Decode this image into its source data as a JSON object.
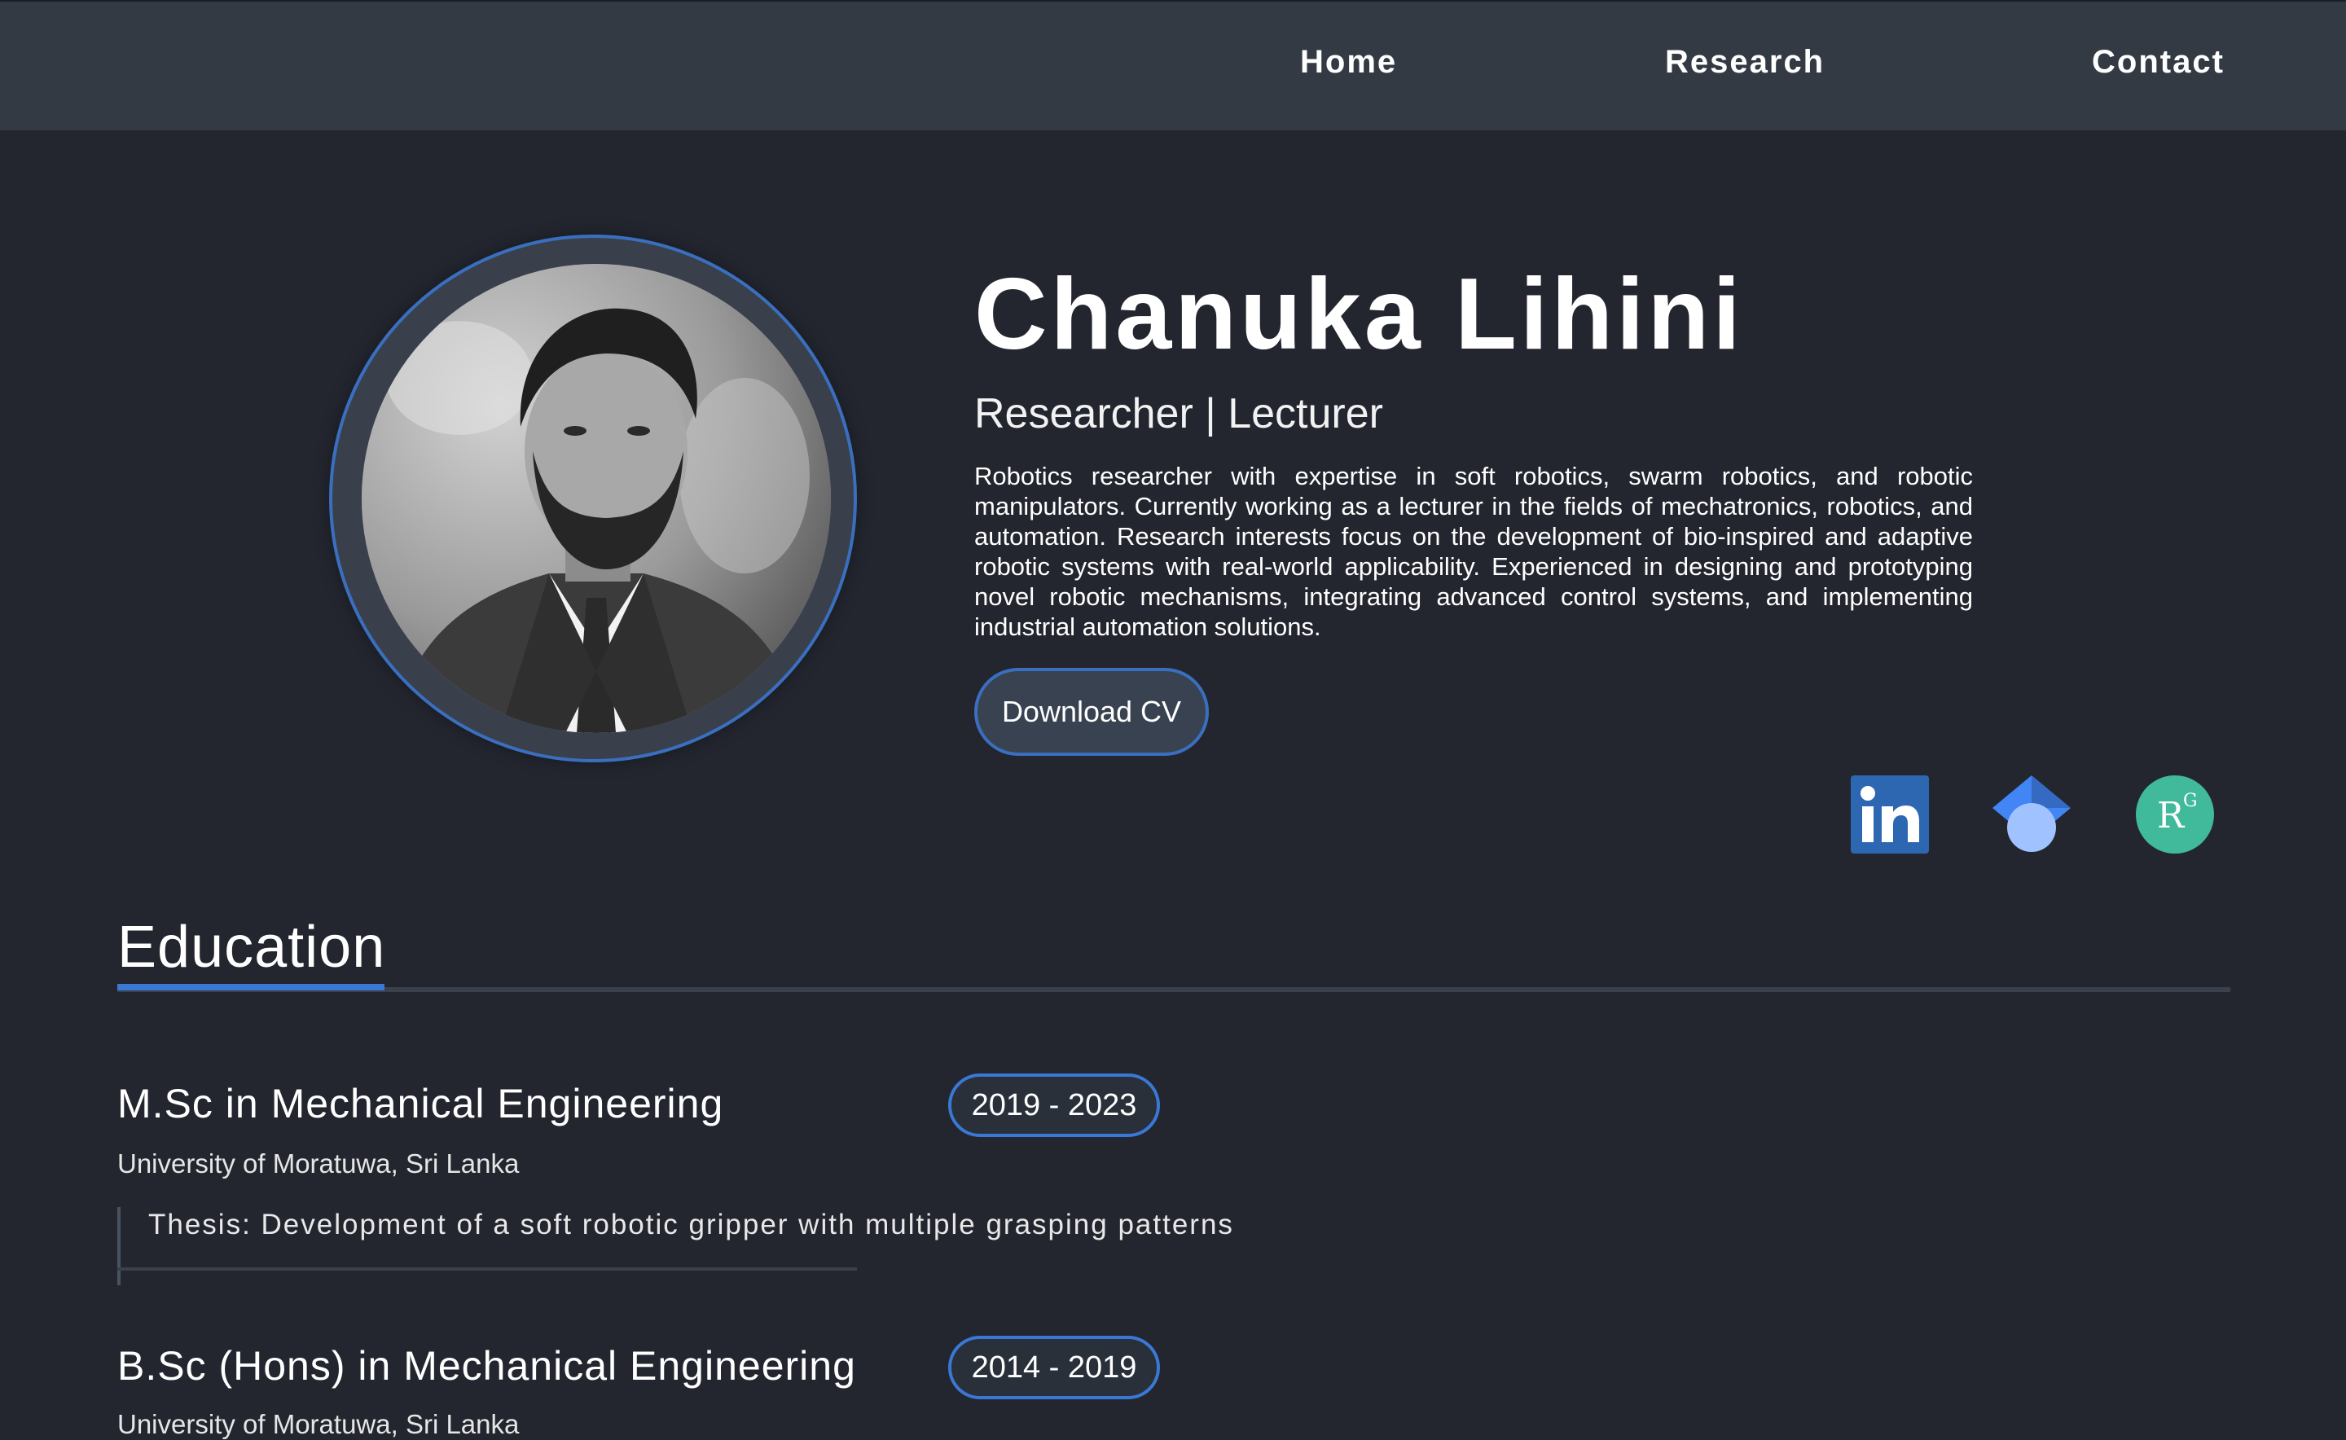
{
  "nav": {
    "home": "Home",
    "research": "Research",
    "contact": "Contact"
  },
  "profile": {
    "name": "Chanuka Lihini",
    "role": "Researcher | Lecturer",
    "bio": "Robotics researcher with expertise in soft robotics, swarm robotics, and robotic manipulators. Currently working as a lecturer in the fields of mechatronics, robotics, and automation. Research interests focus on the development of bio-inspired and adaptive robotic systems with real-world applicability. Experienced in designing and prototyping novel robotic mechanisms, integrating advanced control systems, and implementing industrial automation solutions.",
    "cv_button": "Download CV"
  },
  "social": [
    {
      "icon": "linkedin-icon",
      "color": "#2d67b2"
    },
    {
      "icon": "google-scholar-icon",
      "color": "#4285f4"
    },
    {
      "icon": "researchgate-icon",
      "color": "#40ba9b"
    }
  ],
  "education": {
    "title": "Education",
    "items": [
      {
        "degree": "M.Sc in Mechanical Engineering",
        "years": "2019 - 2023",
        "university": "University of Moratuwa, Sri Lanka",
        "thesis": "Thesis: Development of a soft robotic gripper with multiple grasping patterns"
      },
      {
        "degree": "B.Sc (Hons) in Mechanical Engineering",
        "years": "2014 - 2019",
        "university": "University of Moratuwa, Sri Lanka"
      }
    ]
  },
  "colors": {
    "background": "#23262f",
    "navbar": "#333a44",
    "accent": "#3a78d6"
  }
}
